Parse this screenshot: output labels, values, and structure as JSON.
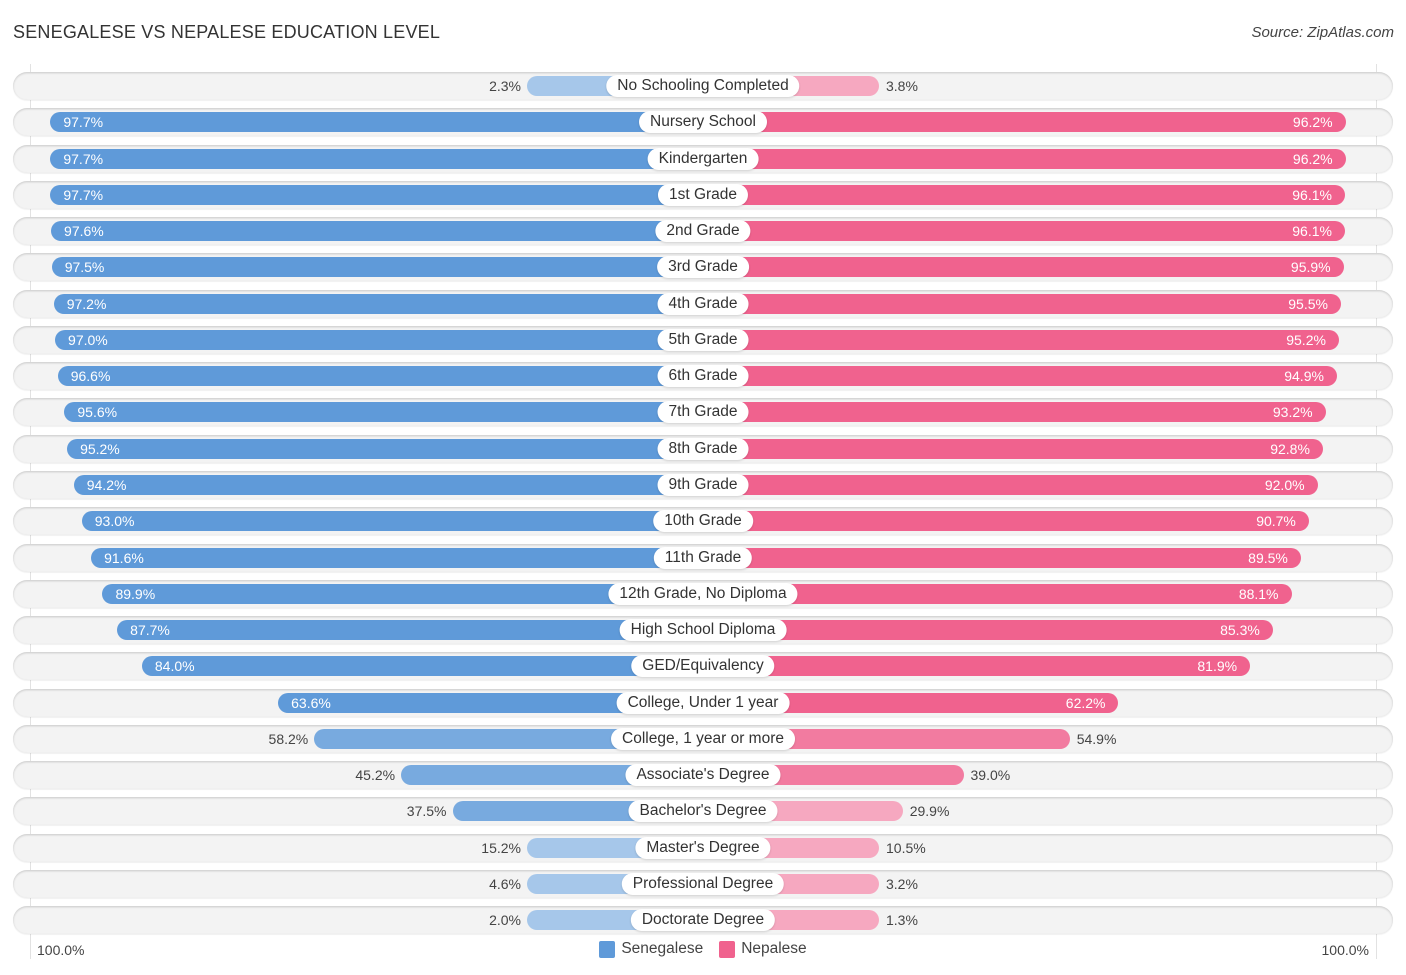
{
  "header": {
    "title": "SENEGALESE VS NEPALESE EDUCATION LEVEL",
    "source": "Source: ZipAtlas.com"
  },
  "colors": {
    "senegalese": "#5f9ad9",
    "senegalese_light": "#a6c7ea",
    "nepalese": "#f0628e",
    "nepalese_light": "#f6a8c0"
  },
  "axis": {
    "left_label": "100.0%",
    "right_label": "100.0%"
  },
  "legend": [
    {
      "name": "Senegalese",
      "color": "#5f9ad9"
    },
    {
      "name": "Nepalese",
      "color": "#f0628e"
    }
  ],
  "chart_data": {
    "type": "bar",
    "orientation": "horizontal-diverging",
    "title": "SENEGALESE VS NEPALESE EDUCATION LEVEL",
    "xlabel": "",
    "ylabel": "",
    "xlim": [
      0,
      100
    ],
    "legend_position": "bottom-center",
    "categories": [
      "No Schooling Completed",
      "Nursery School",
      "Kindergarten",
      "1st Grade",
      "2nd Grade",
      "3rd Grade",
      "4th Grade",
      "5th Grade",
      "6th Grade",
      "7th Grade",
      "8th Grade",
      "9th Grade",
      "10th Grade",
      "11th Grade",
      "12th Grade, No Diploma",
      "High School Diploma",
      "GED/Equivalency",
      "College, Under 1 year",
      "College, 1 year or more",
      "Associate's Degree",
      "Bachelor's Degree",
      "Master's Degree",
      "Professional Degree",
      "Doctorate Degree"
    ],
    "series": [
      {
        "name": "Senegalese",
        "side": "left",
        "values": [
          2.3,
          97.7,
          97.7,
          97.7,
          97.6,
          97.5,
          97.2,
          97.0,
          96.6,
          95.6,
          95.2,
          94.2,
          93.0,
          91.6,
          89.9,
          87.7,
          84.0,
          63.6,
          58.2,
          45.2,
          37.5,
          15.2,
          4.6,
          2.0
        ],
        "labels": [
          "2.3%",
          "97.7%",
          "97.7%",
          "97.7%",
          "97.6%",
          "97.5%",
          "97.2%",
          "97.0%",
          "96.6%",
          "95.6%",
          "95.2%",
          "94.2%",
          "93.0%",
          "91.6%",
          "89.9%",
          "87.7%",
          "84.0%",
          "63.6%",
          "58.2%",
          "45.2%",
          "37.5%",
          "15.2%",
          "4.6%",
          "2.0%"
        ]
      },
      {
        "name": "Nepalese",
        "side": "right",
        "values": [
          3.8,
          96.2,
          96.2,
          96.1,
          96.1,
          95.9,
          95.5,
          95.2,
          94.9,
          93.2,
          92.8,
          92.0,
          90.7,
          89.5,
          88.1,
          85.3,
          81.9,
          62.2,
          54.9,
          39.0,
          29.9,
          10.5,
          3.2,
          1.3
        ],
        "labels": [
          "3.8%",
          "96.2%",
          "96.2%",
          "96.1%",
          "96.1%",
          "95.9%",
          "95.5%",
          "95.2%",
          "94.9%",
          "93.2%",
          "92.8%",
          "92.0%",
          "90.7%",
          "89.5%",
          "88.1%",
          "85.3%",
          "81.9%",
          "62.2%",
          "54.9%",
          "39.0%",
          "29.9%",
          "10.5%",
          "3.2%",
          "1.3%"
        ]
      }
    ]
  }
}
